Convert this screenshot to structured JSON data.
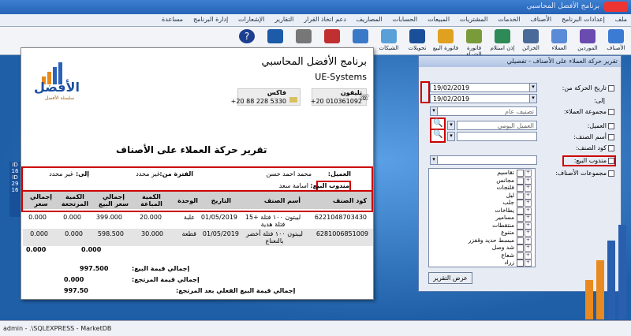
{
  "app": {
    "title": "برنامج الأفضل المحاسبي"
  },
  "menu": [
    "ملف",
    "إعدادات البرنامج",
    "الأصناف",
    "الخدمات",
    "المشتريات",
    "المبيعات",
    "الحسابات",
    "المصاريف",
    "دعم اتخاذ القرار",
    "التقارير",
    "الإشعارات",
    "إدارة البرنامج",
    "مساعدة"
  ],
  "toolbar": [
    "الأصناف",
    "الموردين",
    "العملاء",
    "الخزائن",
    "إذن استلام",
    "فاتورة الشراء",
    "فاتورة البيع",
    "تحويلات",
    "الشيكات",
    "",
    "",
    "",
    "",
    ""
  ],
  "report": {
    "company": "برنامج الأفضل المحاسبي",
    "sub": "UE-Systems",
    "phone_label": "تليفون",
    "phone": "+20 010361092",
    "fax_label": "فاكس",
    "fax": "+20 88 228 5330",
    "logo_text": "الأفضل",
    "logo_sub": "سلسلة الأفضل",
    "title": "تقرير حركة العملاء على الأصناف",
    "client_label": "العميل:",
    "client": "محمد احمد حسن",
    "period_label": "الفترة من:",
    "period_from": "غير محدد",
    "to_label": "إلى:",
    "period_to": "غير محدد",
    "rep_label": "مندوب البيع:",
    "rep": "اسامة سعد",
    "columns": [
      "كود الصنف",
      "أسم الصنف",
      "التاريخ",
      "الوحدة",
      "الكمية المباعة",
      "إجمالي سعر البيع",
      "الكمية المرتجعة",
      "إجمالي سعر"
    ],
    "rows": [
      {
        "code": "6221048703430",
        "name": "ليبتون ١٠٠ فتلة +15 فتلة هدية",
        "date": "01/05/2019",
        "unit": "علبة",
        "qty": "20.000",
        "total": "399.000",
        "ret": "0.000",
        "rtot": "0.000"
      },
      {
        "code": "6281006851009",
        "name": "ليبتون ١٠٠ فتلة أخضر بالنعناع",
        "date": "01/05/2019",
        "unit": "قطعة",
        "qty": "30.000",
        "total": "598.500",
        "ret": "0.000",
        "rtot": "0.000"
      }
    ],
    "sum_ret": "0.000",
    "sum_rtot": "0.000",
    "tot_sales_label": "إجمالي قيمة البيع:",
    "tot_sales": "997.500",
    "tot_ret_label": "إجمالي قيمة المرتجع:",
    "tot_ret": "0.000",
    "net_label": "إجمالي قيمة البيع الفعلي بعد المرتجع:",
    "net": "997.50"
  },
  "dialog": {
    "caption": "تقرير حركة العملاء على الأصناف - تفصيلي",
    "date_from_label": "تاريخ الحركة من:",
    "date_to_label": "إلى:",
    "date_from": "19/02/2019",
    "date_to": "19/02/2019",
    "client_group_label": "مجموعة العملاء:",
    "client_group": "تصنيف عام",
    "client_label": "العميل:",
    "client": "العميل اليومي",
    "item_name_label": "أسم الصنف:",
    "item_code_label": "كود الصنف:",
    "rep_label": "مندوب البيع:",
    "item_groups_label": "مجموعات الأصناف:",
    "tree": [
      "تقاسيم",
      "مجانس",
      "فلنجات",
      "ليل",
      "جلب",
      "يطاخات",
      "مسامير",
      "منتقطات",
      "متنوع",
      "مبسط حديد وقفزر",
      "شد وصل",
      "شعاع",
      "زراد"
    ],
    "show_btn": "عرض التقرير"
  },
  "left": [
    "ID",
    "16",
    "ID",
    "29",
    "16"
  ],
  "status": "admin - .\\SQLEXPRESS - MarketDB"
}
